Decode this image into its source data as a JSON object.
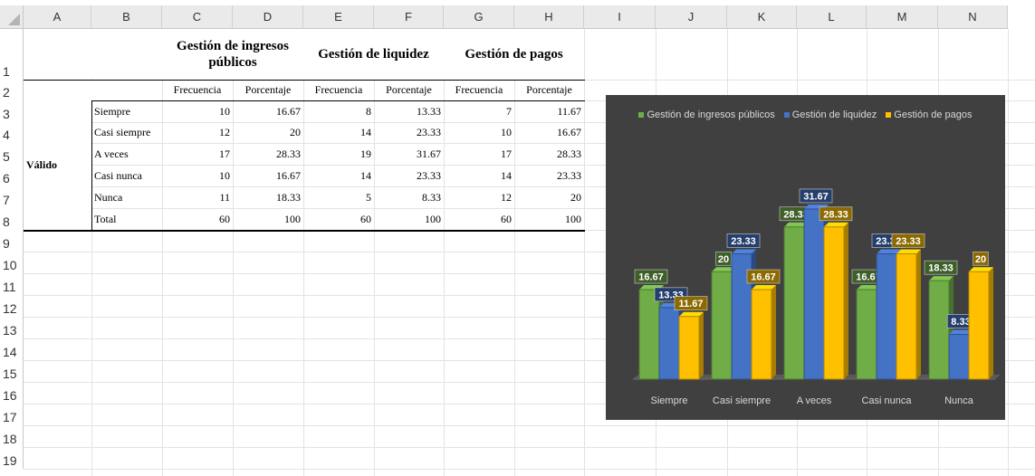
{
  "columns": [
    "A",
    "B",
    "C",
    "D",
    "E",
    "F",
    "G",
    "H",
    "I",
    "J",
    "K",
    "L",
    "M",
    "N"
  ],
  "rows": [
    "1",
    "2",
    "3",
    "4",
    "5",
    "6",
    "7",
    "8",
    "9",
    "10",
    "11",
    "12",
    "13",
    "14",
    "15",
    "16",
    "17",
    "18",
    "19"
  ],
  "groups": [
    "Gestión de ingresos públicos",
    "Gestión de liquidez",
    "Gestión de pagos"
  ],
  "subheaders": [
    "Frecuencia",
    "Porcentaje",
    "Frecuencia",
    "Porcentaje",
    "Frecuencia",
    "Porcentaje"
  ],
  "side_label": "Válido",
  "table": [
    {
      "label": "Siempre",
      "cells": [
        "10",
        "16.67",
        "8",
        "13.33",
        "7",
        "11.67"
      ]
    },
    {
      "label": "Casi siempre",
      "cells": [
        "12",
        "20",
        "14",
        "23.33",
        "10",
        "16.67"
      ]
    },
    {
      "label": "A veces",
      "cells": [
        "17",
        "28.33",
        "19",
        "31.67",
        "17",
        "28.33"
      ]
    },
    {
      "label": "Casi nunca",
      "cells": [
        "10",
        "16.67",
        "14",
        "23.33",
        "14",
        "23.33"
      ]
    },
    {
      "label": "Nunca",
      "cells": [
        "11",
        "18.33",
        "5",
        "8.33",
        "12",
        "20"
      ]
    },
    {
      "label": "Total",
      "cells": [
        "60",
        "100",
        "60",
        "100",
        "60",
        "100"
      ]
    }
  ],
  "chart_data": {
    "type": "bar",
    "categories": [
      "Siempre",
      "Casi siempre",
      "A veces",
      "Casi nunca",
      "Nunca"
    ],
    "series": [
      {
        "name": "Gestión de ingresos públicos",
        "color": "#70ad47",
        "values": [
          16.67,
          20,
          28.33,
          16.67,
          18.33
        ]
      },
      {
        "name": "Gestión de liquidez",
        "color": "#4472c4",
        "values": [
          13.33,
          23.33,
          31.67,
          23.33,
          8.33
        ]
      },
      {
        "name": "Gestión de pagos",
        "color": "#ffc000",
        "values": [
          11.67,
          16.67,
          28.33,
          23.33,
          20
        ]
      }
    ],
    "ylim": [
      0,
      35
    ],
    "legend": "top",
    "grid": false,
    "background": "#404040"
  }
}
